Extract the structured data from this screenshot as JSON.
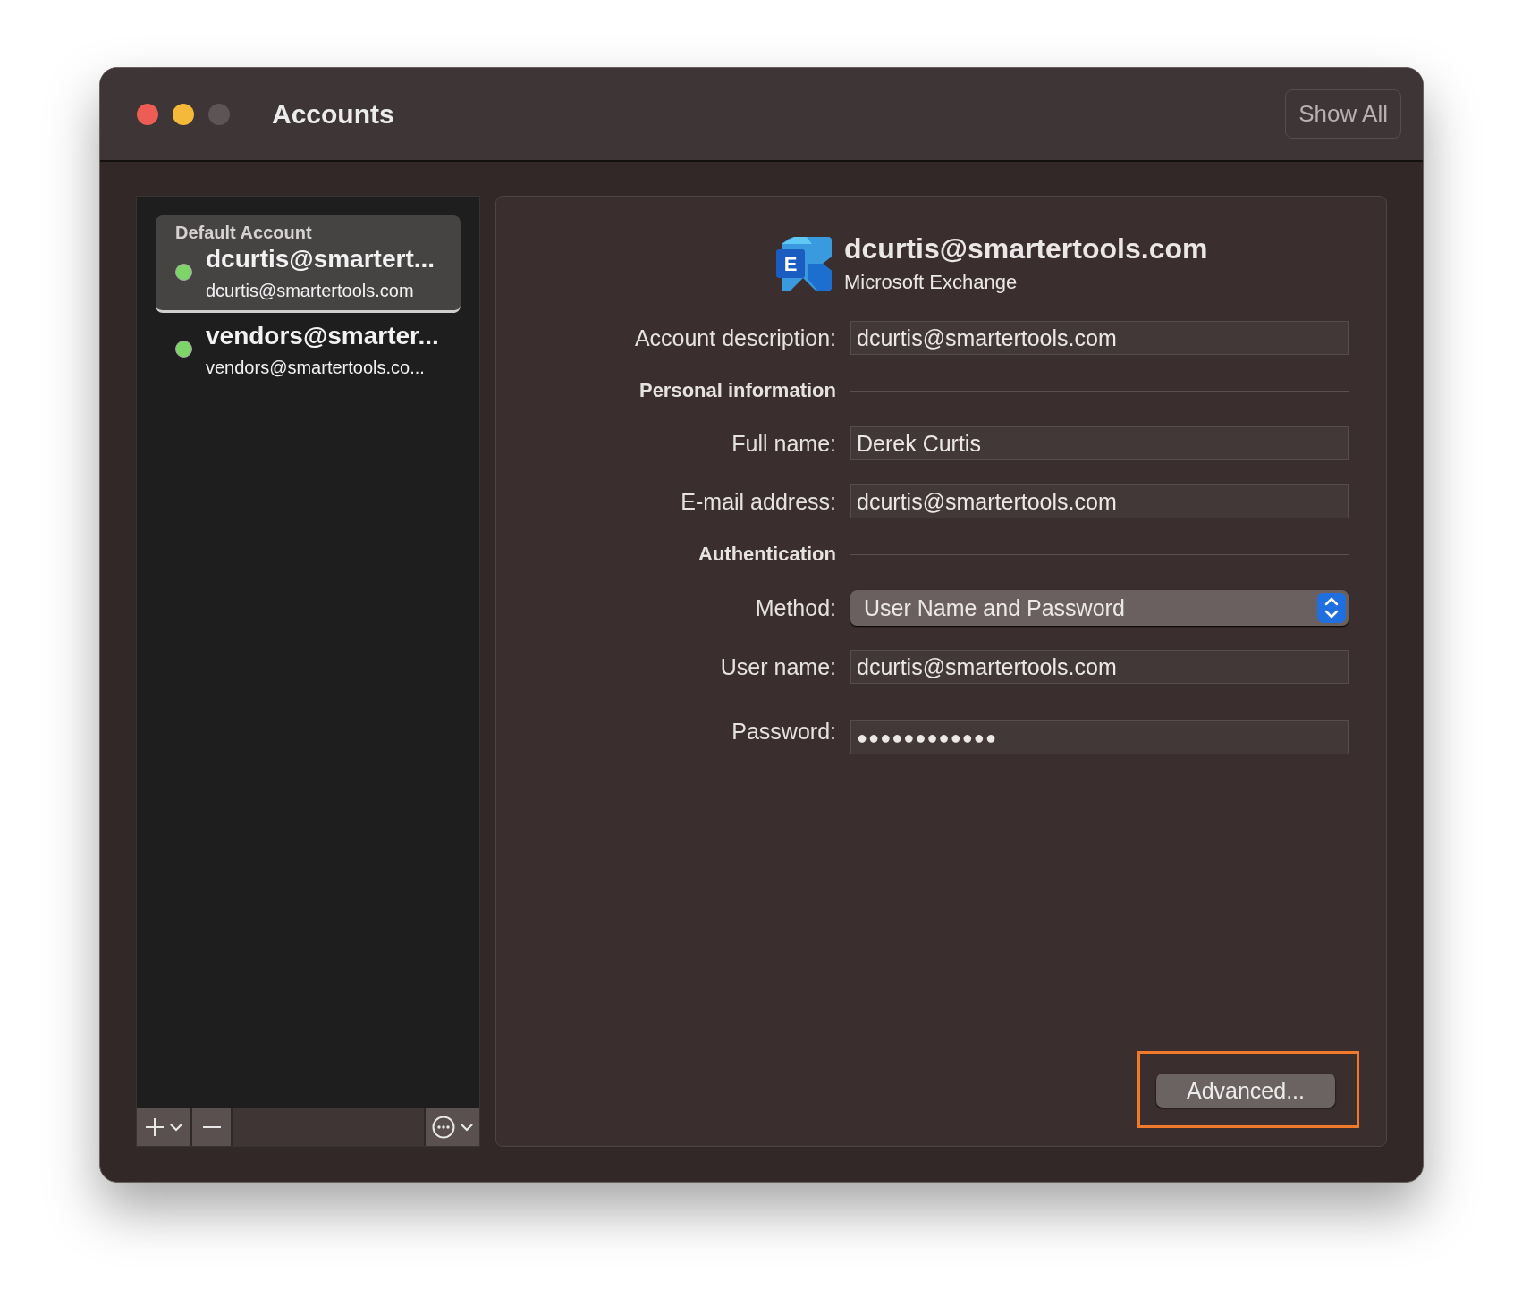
{
  "window": {
    "title": "Accounts",
    "show_all": "Show All"
  },
  "sidebar": {
    "accounts": [
      {
        "group_label": "Default Account",
        "name": "dcurtis@smartert...",
        "email": "dcurtis@smartertools.com",
        "selected": true,
        "color": "#7dd56a"
      },
      {
        "name": "vendors@smarter...",
        "email": "vendors@smartertools.co...",
        "selected": false,
        "color": "#7dd56a"
      }
    ]
  },
  "detail": {
    "logo_letter": "E",
    "title": "dcurtis@smartertools.com",
    "subtitle": "Microsoft Exchange",
    "rows": [
      {
        "kind": "field",
        "label": "Account description:",
        "value": "dcurtis@smartertools.com"
      },
      {
        "kind": "section",
        "label": "Personal information"
      },
      {
        "kind": "field",
        "label": "Full name:",
        "value": "Derek Curtis"
      },
      {
        "kind": "field",
        "label": "E-mail address:",
        "value": "dcurtis@smartertools.com"
      },
      {
        "kind": "section",
        "label": "Authentication"
      },
      {
        "kind": "select",
        "label": "Method:",
        "value": "User Name and Password"
      },
      {
        "kind": "field",
        "label": "User name:",
        "value": "dcurtis@smartertools.com"
      },
      {
        "kind": "password",
        "label": "Password:",
        "value": "●●●●●●●●●●●●"
      }
    ],
    "advanced": {
      "label": "Advanced...",
      "highlighted": true
    }
  }
}
